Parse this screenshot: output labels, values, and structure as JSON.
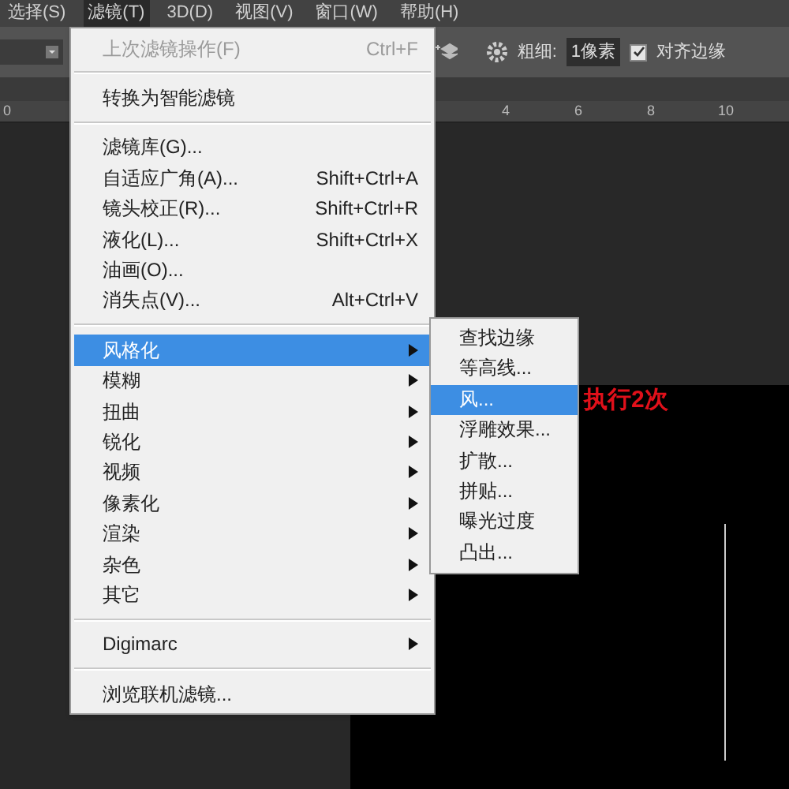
{
  "menubar": [
    {
      "label": "选择(S)",
      "selected": false
    },
    {
      "label": "滤镜(T)",
      "selected": true
    },
    {
      "label": "3D(D)",
      "selected": false
    },
    {
      "label": "视图(V)",
      "selected": false
    },
    {
      "label": "窗口(W)",
      "selected": false
    },
    {
      "label": "帮助(H)",
      "selected": false
    }
  ],
  "options_bar": {
    "width_label": "粗细:",
    "width_value": "1像素",
    "align_edges": {
      "label": "对齐边缘",
      "checked": true
    }
  },
  "ruler": [
    "0",
    "4",
    "6",
    "8",
    "10"
  ],
  "filter_menu": [
    [
      {
        "label": "上次滤镜操作(F)",
        "shortcut": "Ctrl+F",
        "disabled": true,
        "selected": false,
        "has_submenu": false
      }
    ],
    [
      {
        "label": "转换为智能滤镜",
        "disabled": false,
        "selected": false,
        "has_submenu": false
      }
    ],
    [
      {
        "label": "滤镜库(G)...",
        "disabled": false,
        "selected": false,
        "has_submenu": false
      },
      {
        "label": "自适应广角(A)...",
        "shortcut": "Shift+Ctrl+A",
        "disabled": false,
        "selected": false,
        "has_submenu": false
      },
      {
        "label": "镜头校正(R)...",
        "shortcut": "Shift+Ctrl+R",
        "disabled": false,
        "selected": false,
        "has_submenu": false
      },
      {
        "label": "液化(L)...",
        "shortcut": "Shift+Ctrl+X",
        "disabled": false,
        "selected": false,
        "has_submenu": false
      },
      {
        "label": "油画(O)...",
        "disabled": false,
        "selected": false,
        "has_submenu": false
      },
      {
        "label": "消失点(V)...",
        "shortcut": "Alt+Ctrl+V",
        "disabled": false,
        "selected": false,
        "has_submenu": false
      }
    ],
    [
      {
        "label": "风格化",
        "disabled": false,
        "selected": true,
        "has_submenu": true
      },
      {
        "label": "模糊",
        "disabled": false,
        "selected": false,
        "has_submenu": true
      },
      {
        "label": "扭曲",
        "disabled": false,
        "selected": false,
        "has_submenu": true
      },
      {
        "label": "锐化",
        "disabled": false,
        "selected": false,
        "has_submenu": true
      },
      {
        "label": "视频",
        "disabled": false,
        "selected": false,
        "has_submenu": true
      },
      {
        "label": "像素化",
        "disabled": false,
        "selected": false,
        "has_submenu": true
      },
      {
        "label": "渲染",
        "disabled": false,
        "selected": false,
        "has_submenu": true
      },
      {
        "label": "杂色",
        "disabled": false,
        "selected": false,
        "has_submenu": true
      },
      {
        "label": "其它",
        "disabled": false,
        "selected": false,
        "has_submenu": true
      }
    ],
    [
      {
        "label": "Digimarc",
        "disabled": false,
        "selected": false,
        "has_submenu": true
      }
    ],
    [
      {
        "label": "浏览联机滤镜...",
        "disabled": false,
        "selected": false,
        "has_submenu": false
      }
    ]
  ],
  "stylize_submenu": [
    {
      "label": "查找边缘",
      "selected": false
    },
    {
      "label": "等高线...",
      "selected": false
    },
    {
      "label": "风...",
      "selected": true
    },
    {
      "label": "浮雕效果...",
      "selected": false
    },
    {
      "label": "扩散...",
      "selected": false
    },
    {
      "label": "拼贴...",
      "selected": false
    },
    {
      "label": "曝光过度",
      "selected": false
    },
    {
      "label": "凸出...",
      "selected": false
    }
  ],
  "annotation": "执行2次"
}
